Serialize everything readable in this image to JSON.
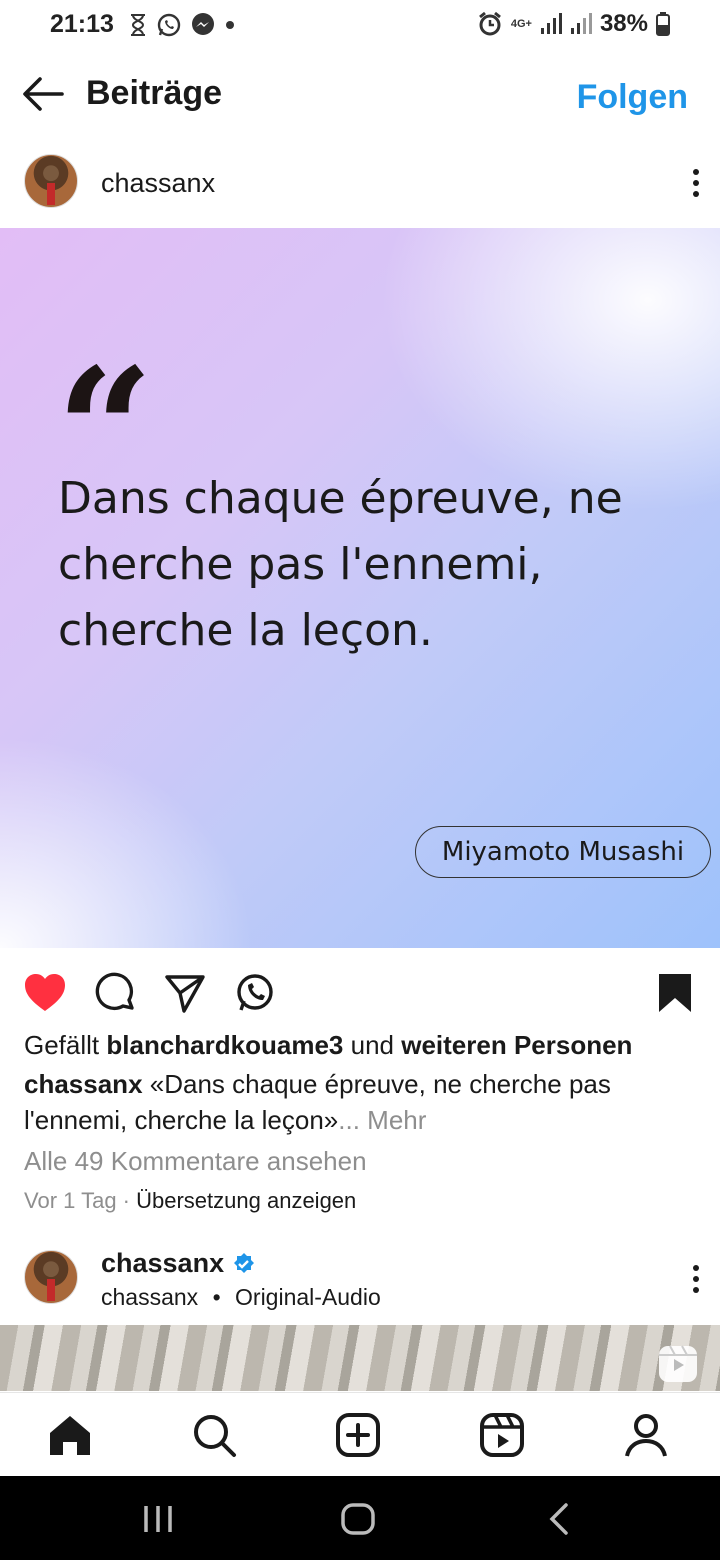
{
  "status_bar": {
    "time": "21:13",
    "network": "4G+",
    "battery": "38%"
  },
  "header": {
    "title": "Beiträge",
    "follow_label": "Folgen"
  },
  "post": {
    "username": "chassanx",
    "image": {
      "quote_mark": "“",
      "quote_text": "Dans chaque épreuve, ne cherche pas l'ennemi, cherche la leçon.",
      "attribution": "Miyamoto Musashi"
    },
    "liked": true,
    "saved": true,
    "likes": {
      "prefix": "Gefällt",
      "user": "blanchardkouame3",
      "middle": "und",
      "rest": "weiteren Personen"
    },
    "caption": {
      "user": "chassanx",
      "text": "«Dans chaque épreuve, ne cherche pas l'ennemi, cherche la leçon»",
      "more": "... Mehr"
    },
    "view_comments": "Alle 49 Kommentare ansehen",
    "time_ago": "Vor 1 Tag",
    "separator": " · ",
    "translate": "Übersetzung anzeigen"
  },
  "next_post": {
    "username": "chassanx",
    "verified": true,
    "sub_user": "chassanx",
    "bullet": "•",
    "audio": "Original-Audio"
  },
  "colors": {
    "accent": "#1f95e8",
    "like": "#ff3040",
    "verified": "#1f95e8"
  }
}
